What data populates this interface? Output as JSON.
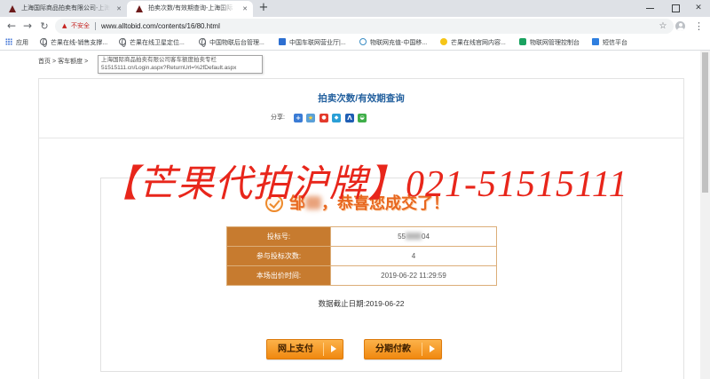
{
  "browser": {
    "tabs": [
      {
        "title": "上海国际商品拍卖有限公司-上海",
        "active": false
      },
      {
        "title": "拍卖次数/有效期查询-上海国际",
        "active": true
      }
    ],
    "security_label": "不安全",
    "url": "www.alltobid.com/contents/16/80.html",
    "bookmarks": [
      {
        "label": "应用",
        "icon": "apps-grid-icon"
      },
      {
        "label": "芒果在线-销售支撑...",
        "icon": "globe-icon"
      },
      {
        "label": "芒果在线卫星定位...",
        "icon": "globe-icon"
      },
      {
        "label": "中国物联后台管理...",
        "icon": "globe-icon"
      },
      {
        "label": "中国车联网营业厅|...",
        "icon": "car-network-icon"
      },
      {
        "label": "物联网充值-中国移...",
        "icon": "mobile-recharge-icon"
      },
      {
        "label": "芒果在线官网内容...",
        "icon": "mango-site-icon"
      },
      {
        "label": "物联网管理控制台",
        "icon": "iot-console-icon"
      },
      {
        "label": "短信平台",
        "icon": "sms-icon"
      }
    ],
    "icons": {
      "back": "arrow-left-icon",
      "forward": "arrow-right-icon",
      "reload": "reload-icon",
      "security": "warning-triangle-icon",
      "bookmark_star": "star-icon",
      "profile": "avatar-icon",
      "menu": "kebab-menu-icon",
      "new_tab": "plus-icon",
      "close_tab": "close-icon"
    }
  },
  "page": {
    "breadcrumb": {
      "home": "首页",
      "section": "客车额度",
      "separator": ">"
    },
    "link_tooltip": {
      "title": "上海国际商品拍卖有限公司客车额度拍卖专栏",
      "url": "51515111.cn/Login.aspx?ReturnUrl=%2fDefault.aspx"
    },
    "title": "拍卖次数/有效期查询",
    "share": {
      "label": "分享:",
      "icons": [
        "share-more-icon",
        "share-qzone-icon",
        "share-weibo-icon",
        "share-tqq-icon",
        "share-renren-icon",
        "share-wechat-icon"
      ]
    },
    "watermark": "【芒果代拍沪牌】021-51515111",
    "result": {
      "name_visible": "邹",
      "message": "，恭喜您成交了！",
      "rows": [
        {
          "label": "投标号:",
          "value_start": "55",
          "value_end": "04"
        },
        {
          "label": "参与投标次数:",
          "value": "4"
        },
        {
          "label": "本场出价时间:",
          "value": "2019-06-22 11:29:59"
        }
      ],
      "data_cutoff": "数据截止日期:2019-06-22"
    },
    "buttons": {
      "online_pay": "网上支付",
      "installment": "分期付款"
    }
  },
  "colors": {
    "watermark": "#e8261b",
    "label_cell": "#c77b2f",
    "title": "#23609e",
    "button_top": "#fcb24a",
    "button_bottom": "#f0880f",
    "success": "#e8671f",
    "insecure": "#c5221f"
  }
}
